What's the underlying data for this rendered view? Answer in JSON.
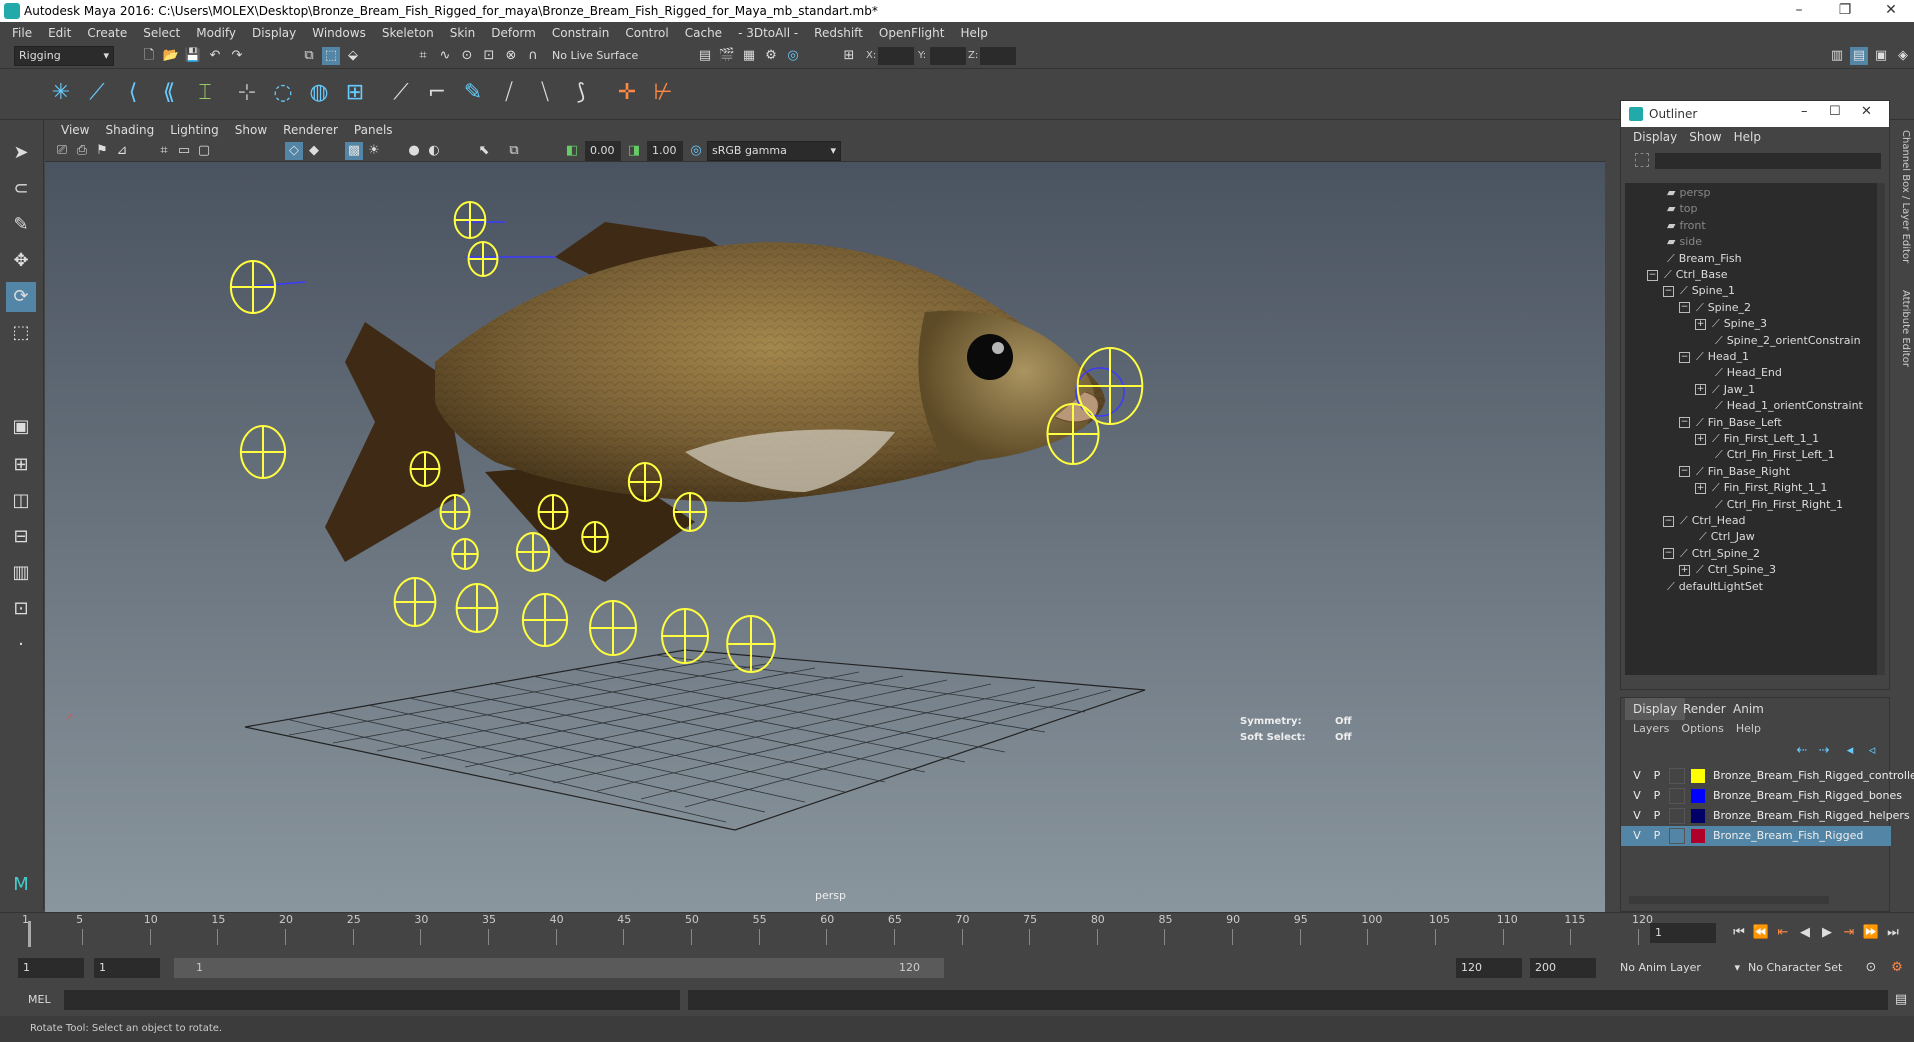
{
  "window": {
    "title": "Autodesk Maya 2016: C:\\Users\\MOLEX\\Desktop\\Bronze_Bream_Fish_Rigged_for_maya\\Bronze_Bream_Fish_Rigged_for_Maya_mb_standart.mb*"
  },
  "menubar": [
    "File",
    "Edit",
    "Create",
    "Select",
    "Modify",
    "Display",
    "Windows",
    "Skeleton",
    "Skin",
    "Deform",
    "Constrain",
    "Control",
    "Cache",
    "- 3DtoAll -",
    "Redshift",
    "OpenFlight",
    "Help"
  ],
  "statusline": {
    "menuset": "Rigging",
    "live_surface": "No Live Surface",
    "x_label": "X:",
    "y_label": "Y:",
    "z_label": "Z:"
  },
  "panel_menu": [
    "View",
    "Shading",
    "Lighting",
    "Show",
    "Renderer",
    "Panels"
  ],
  "panel_toolbar": {
    "exposure": "0.00",
    "gamma": "1.00",
    "color_space": "sRGB gamma"
  },
  "viewport": {
    "camera": "persp",
    "symmetry_label": "Symmetry:",
    "symmetry_value": "Off",
    "soft_select_label": "Soft Select:",
    "soft_select_value": "Off",
    "accent_color": "#ffff40"
  },
  "outliner": {
    "title": "Outliner",
    "menu": [
      "Display",
      "Show",
      "Help"
    ],
    "items": [
      {
        "label": "persp",
        "dim": true,
        "indent": 0,
        "exp": ""
      },
      {
        "label": "top",
        "dim": true,
        "indent": 0,
        "exp": ""
      },
      {
        "label": "front",
        "dim": true,
        "indent": 0,
        "exp": ""
      },
      {
        "label": "side",
        "dim": true,
        "indent": 0,
        "exp": ""
      },
      {
        "label": "Bream_Fish",
        "dim": false,
        "indent": 0,
        "exp": ""
      },
      {
        "label": "Ctrl_Base",
        "dim": false,
        "indent": 0,
        "exp": "−"
      },
      {
        "label": "Spine_1",
        "dim": false,
        "indent": 1,
        "exp": "−"
      },
      {
        "label": "Spine_2",
        "dim": false,
        "indent": 2,
        "exp": "−"
      },
      {
        "label": "Spine_3",
        "dim": false,
        "indent": 3,
        "exp": "+"
      },
      {
        "label": "Spine_2_orientConstrain",
        "dim": false,
        "indent": 3,
        "exp": ""
      },
      {
        "label": "Head_1",
        "dim": false,
        "indent": 2,
        "exp": "−"
      },
      {
        "label": "Head_End",
        "dim": false,
        "indent": 3,
        "exp": ""
      },
      {
        "label": "Jaw_1",
        "dim": false,
        "indent": 3,
        "exp": "+"
      },
      {
        "label": "Head_1_orientConstraint",
        "dim": false,
        "indent": 3,
        "exp": ""
      },
      {
        "label": "Fin_Base_Left",
        "dim": false,
        "indent": 2,
        "exp": "−"
      },
      {
        "label": "Fin_First_Left_1_1",
        "dim": false,
        "indent": 3,
        "exp": "+"
      },
      {
        "label": "Ctrl_Fin_First_Left_1",
        "dim": false,
        "indent": 3,
        "exp": ""
      },
      {
        "label": "Fin_Base_Right",
        "dim": false,
        "indent": 2,
        "exp": "−"
      },
      {
        "label": "Fin_First_Right_1_1",
        "dim": false,
        "indent": 3,
        "exp": "+"
      },
      {
        "label": "Ctrl_Fin_First_Right_1",
        "dim": false,
        "indent": 3,
        "exp": ""
      },
      {
        "label": "Ctrl_Head",
        "dim": false,
        "indent": 1,
        "exp": "−"
      },
      {
        "label": "Ctrl_Jaw",
        "dim": false,
        "indent": 2,
        "exp": ""
      },
      {
        "label": "Ctrl_Spine_2",
        "dim": false,
        "indent": 1,
        "exp": "−"
      },
      {
        "label": "Ctrl_Spine_3",
        "dim": false,
        "indent": 2,
        "exp": "+"
      },
      {
        "label": "defaultLightSet",
        "dim": false,
        "indent": 0,
        "exp": ""
      }
    ]
  },
  "side_tabs": {
    "channel_box": "Channel Box / Layer Editor",
    "attribute_editor": "Attribute Editor"
  },
  "layer_editor": {
    "tabs": [
      "Display",
      "Render",
      "Anim"
    ],
    "menu": [
      "Layers",
      "Options",
      "Help"
    ],
    "layers": [
      {
        "v": "V",
        "p": "P",
        "name": "Bronze_Bream_Fish_Rigged_controllers",
        "color": "#ffff00",
        "selected": false
      },
      {
        "v": "V",
        "p": "P",
        "name": "Bronze_Bream_Fish_Rigged_bones",
        "color": "#0000ff",
        "selected": false
      },
      {
        "v": "V",
        "p": "P",
        "name": "Bronze_Bream_Fish_Rigged_helpers",
        "color": "#000066",
        "selected": false
      },
      {
        "v": "V",
        "p": "P",
        "name": "Bronze_Bream_Fish_Rigged",
        "color": "#b0002a",
        "selected": true
      }
    ]
  },
  "timeline": {
    "ticks": [
      "1",
      "5",
      "10",
      "15",
      "20",
      "25",
      "30",
      "35",
      "40",
      "45",
      "50",
      "55",
      "60",
      "65",
      "70",
      "75",
      "80",
      "85",
      "90",
      "95",
      "100",
      "105",
      "110",
      "115",
      "120"
    ],
    "current_frame": "1"
  },
  "range": {
    "start": "1",
    "playback_start": "1",
    "slider_start": "1",
    "slider_end": "120",
    "playback_end": "120",
    "end": "200",
    "anim_layer": "No Anim Layer",
    "character_set": "No Character Set"
  },
  "command_line": {
    "label": "MEL"
  },
  "help_line": {
    "text": "Rotate Tool: Select an object to rotate."
  }
}
